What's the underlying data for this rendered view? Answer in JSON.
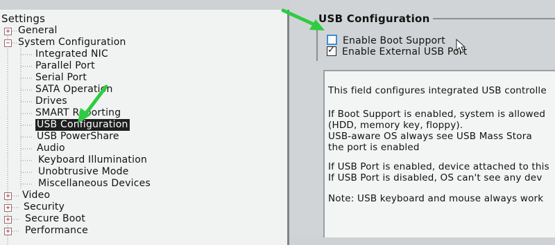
{
  "tree": {
    "title": "Settings",
    "items": [
      {
        "label": "General",
        "expander": "+"
      },
      {
        "label": "System Configuration",
        "expander": "−"
      },
      {
        "label": "Integrated NIC"
      },
      {
        "label": "Parallel Port"
      },
      {
        "label": "Serial Port"
      },
      {
        "label": "SATA Operation"
      },
      {
        "label": "Drives"
      },
      {
        "label": "SMART Reporting"
      },
      {
        "label": "USB Configuration",
        "selected": true
      },
      {
        "label": "USB PowerShare"
      },
      {
        "label": "Audio"
      },
      {
        "label": "Keyboard Illumination"
      },
      {
        "label": "Unobtrusive Mode"
      },
      {
        "label": "Miscellaneous Devices"
      },
      {
        "label": "Video",
        "expander": "+"
      },
      {
        "label": "Security",
        "expander": "+"
      },
      {
        "label": "Secure Boot",
        "expander": "+"
      },
      {
        "label": "Performance",
        "expander": "+"
      }
    ]
  },
  "panel": {
    "title": "USB Configuration",
    "options": [
      {
        "label": "Enable Boot Support",
        "checked": false,
        "mark": ""
      },
      {
        "label": "Enable External USB Port",
        "checked": true,
        "mark": "✓"
      }
    ],
    "help_lines": [
      "This field configures integrated USB controlle",
      "If Boot Support is enabled, system is allowed",
      "(HDD, memory key, floppy).",
      "USB-aware OS always see USB Mass Stora",
      "the port is enabled",
      "If USB Port is enabled, device attached to this",
      "If USB Port is disabled, OS can't see any dev",
      "Note: USB keyboard and mouse always work"
    ]
  },
  "icons": {
    "annotation_arrow": "green-arrow-icon",
    "cursor": "mouse-pointer-icon"
  },
  "colors": {
    "annotation_green": "#2ecc40",
    "selection": "#1f1f1f",
    "checkbox_focus": "#3b8fd6"
  }
}
